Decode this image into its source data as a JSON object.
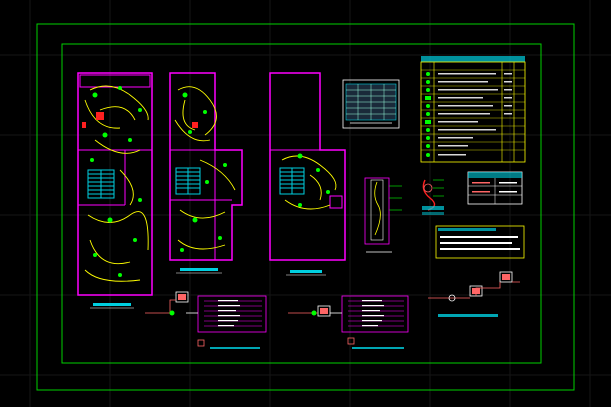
{
  "drawing": {
    "layers": {
      "frame": "#00d000",
      "walls": "#ff00ff",
      "wiring": "#ffff00",
      "fixtures": "#00ff00",
      "stairs": "#00cfe0",
      "panel": "#ff6666",
      "text": "#ffffff",
      "caption": "#00cfe0",
      "accent": "#ff2020"
    },
    "grid_visible": true
  }
}
